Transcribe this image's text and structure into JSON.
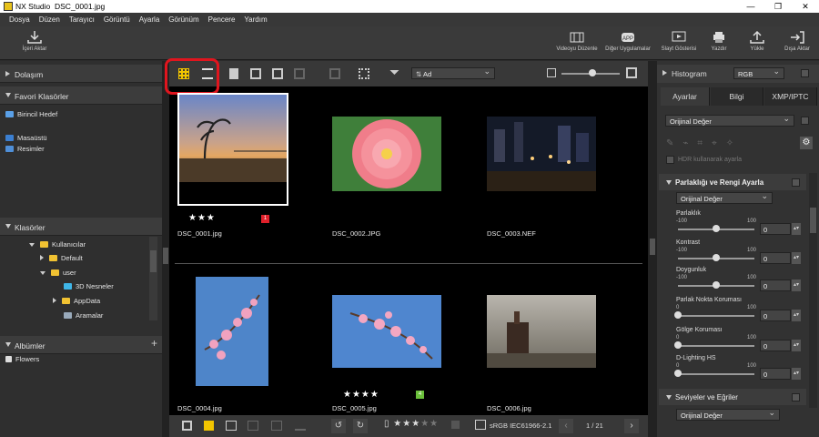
{
  "window": {
    "app_name": "NX Studio",
    "file_name": "DSC_0001.jpg"
  },
  "menu": [
    "Dosya",
    "Düzen",
    "Tarayıcı",
    "Görüntü",
    "Ayarla",
    "Görünüm",
    "Pencere",
    "Yardım"
  ],
  "toolbar": {
    "import": "İçeri Aktar",
    "movie_editor": "Videoyu Düzenle",
    "other_apps": "Diğer Uygulamalar",
    "slideshow": "Slayt Gösterisi",
    "print": "Yazdır",
    "upload": "Yükle",
    "export": "Dışa Aktar"
  },
  "left": {
    "navigation": "Dolaşım",
    "favorites": "Favori Klasörler",
    "primary_target": "Birincil Hedef",
    "desktop": "Masaüstü",
    "pictures": "Resimler",
    "folders": "Klasörler",
    "tree": [
      "Kullanıcılar",
      "Default",
      "user",
      "3D Nesneler",
      "AppData",
      "Aramalar"
    ],
    "albums": "Albümler",
    "flowers": "Flowers"
  },
  "center": {
    "sort_by": "Ad",
    "page": "1 / 21",
    "color_space": "sRGB IEC61966-2.1",
    "files": [
      {
        "name": "DSC_0001.jpg",
        "rating": 3,
        "label": "1",
        "label_color": "#e0202a"
      },
      {
        "name": "DSC_0002.JPG"
      },
      {
        "name": "DSC_0003.NEF"
      },
      {
        "name": "DSC_0004.jpg"
      },
      {
        "name": "DSC_0005.jpg",
        "rating": 4,
        "label": "4",
        "label_color": "#6abf3a"
      },
      {
        "name": "DSC_0006.jpg"
      }
    ]
  },
  "right": {
    "histogram": "Histogram",
    "histogram_mode": "RGB",
    "tabs": [
      "Ayarlar",
      "Bilgi",
      "XMP/IPTC"
    ],
    "preset": "Orijinal Değer",
    "hdr": "HDR kullanarak ayarla",
    "section_brightness": "Parlaklığı ve Rengi Ayarla",
    "brightness_preset": "Orijinal Değer",
    "sliders": [
      {
        "label": "Parlaklık",
        "min": "-100",
        "max": "100",
        "value": "0"
      },
      {
        "label": "Kontrast",
        "min": "-100",
        "max": "100",
        "value": "0"
      },
      {
        "label": "Doygunluk",
        "min": "-100",
        "max": "100",
        "value": "0"
      },
      {
        "label": "Parlak Nokta Koruması",
        "min": "0",
        "max": "100",
        "value": "0"
      },
      {
        "label": "Gölge Koruması",
        "min": "0",
        "max": "100",
        "value": "0"
      },
      {
        "label": "D-Lighting HS",
        "min": "0",
        "max": "100",
        "value": "0"
      }
    ],
    "section_levels": "Seviyeler ve Eğriler",
    "levels_preset": "Orijinal Değer"
  }
}
